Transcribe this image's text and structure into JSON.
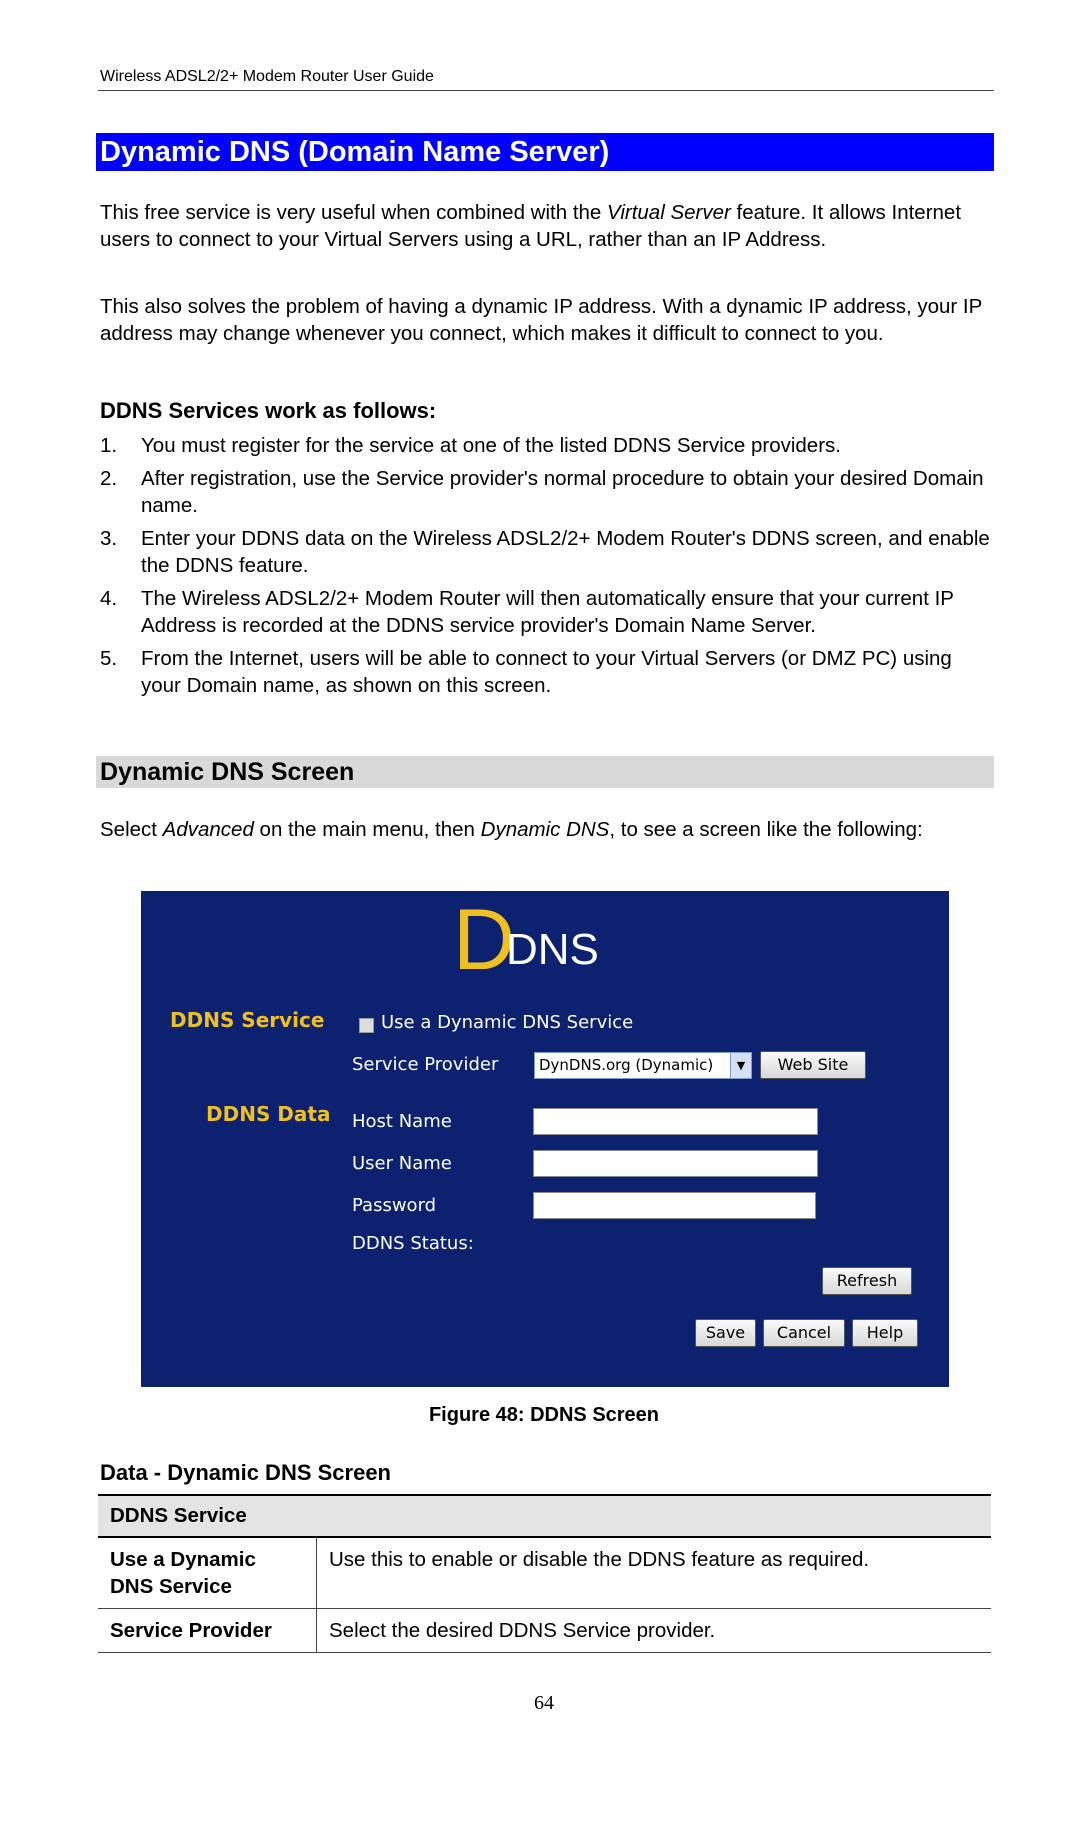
{
  "running_header": "Wireless ADSL2/2+ Modem Router User Guide",
  "title": "Dynamic DNS (Domain Name Server)",
  "intro": {
    "p1_before": "This free service is very useful when combined with the ",
    "p1_italic": "Virtual Server",
    "p1_after": " feature. It allows Internet users to connect to your Virtual Servers using a URL, rather than an IP Address.",
    "p2": "This also solves the problem of having a dynamic IP address. With a dynamic IP address, your IP address may change whenever you connect, which makes it difficult to connect to you."
  },
  "how_heading": "DDNS Services work as follows:",
  "steps": [
    {
      "num": "1.",
      "text": "You must register for the service at one of the listed DDNS Service providers."
    },
    {
      "num": "2.",
      "text": "After registration, use the Service provider's normal procedure to obtain your desired Domain name."
    },
    {
      "num": "3.",
      "text": "Enter your DDNS data on the Wireless ADSL2/2+ Modem Router's DDNS screen, and enable the DDNS feature."
    },
    {
      "num": "4.",
      "text": "The Wireless ADSL2/2+ Modem Router will then automatically ensure that your current IP Address is recorded at the DDNS service provider's Domain Name Server."
    },
    {
      "num": "5.",
      "text": "From the Internet, users will be able to connect to your Virtual Servers (or DMZ PC) using your Domain name, as shown on this screen."
    }
  ],
  "screen_section": {
    "heading": "Dynamic DNS Screen",
    "p_before": "Select ",
    "p_italic1": "Advanced",
    "p_mid": " on the main menu, then ",
    "p_italic2": "Dynamic DNS",
    "p_after": ", to see a screen like the following:"
  },
  "ddns_panel": {
    "logo_big": "D",
    "logo_rest": "DNS",
    "service_label": "DDNS Service",
    "use_checkbox_label": "Use a Dynamic DNS Service",
    "use_checkbox_checked": false,
    "provider_label": "Service Provider",
    "provider_value": "DynDNS.org (Dynamic)",
    "web_site_button": "Web Site",
    "data_label": "DDNS Data",
    "host_label": "Host Name",
    "host_value": "",
    "user_label": "User Name",
    "user_value": "",
    "password_label": "Password",
    "password_value": "",
    "status_label": "DDNS Status:",
    "refresh_button": "Refresh",
    "save_button": "Save",
    "cancel_button": "Cancel",
    "help_button": "Help",
    "colors": {
      "background": "#0c2270",
      "accent": "#f0c020"
    }
  },
  "figure_caption": "Figure 48: DDNS Screen",
  "data_heading": "Data - Dynamic DNS Screen",
  "data_table": {
    "section": "DDNS Service",
    "rows": [
      {
        "key": "Use a Dynamic DNS Service",
        "value": "Use this to enable or disable the DDNS feature as required."
      },
      {
        "key": "Service Provider",
        "value": "Select the desired DDNS Service provider."
      }
    ]
  },
  "page_number": "64"
}
